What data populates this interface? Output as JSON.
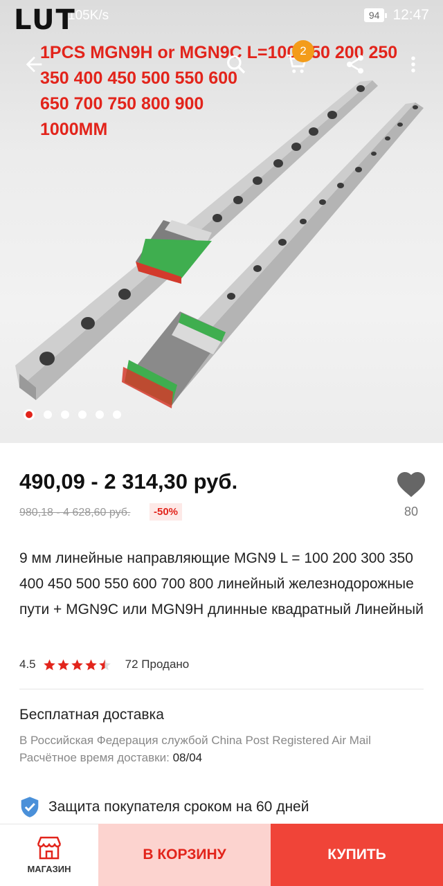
{
  "status_bar": {
    "carrier_logo": "LUT",
    "network_speed": "105K/s",
    "battery": "94",
    "time": "12:47"
  },
  "hero": {
    "promo_lines": [
      "1PCS MGN9H or MGN9C L=100 150 200 250",
      "350 400 450 500 550 600",
      "650 700 750 800 900",
      "1000MM"
    ],
    "cart_count": "2",
    "slides_total": 6,
    "active_slide": 1,
    "icons": [
      "back-arrow-icon",
      "search-icon",
      "cart-icon",
      "share-icon",
      "more-vertical-icon"
    ]
  },
  "product": {
    "price": "490,09 - 2 314,30 руб.",
    "old_price": "980,18 - 4 628,60 руб.",
    "discount": "-50%",
    "favorites_count": "80",
    "title": "9 мм линейные направляющие MGN9 L = 100 200 300 350 400 450 500 550 600 700 800 линейный железнодорожные пути + MGN9C или MGN9H длинные квадратный Линейный",
    "rating": "4.5",
    "rating_value": 4.5,
    "sold": "72 Продано"
  },
  "shipping": {
    "title": "Бесплатная доставка",
    "description": "В Российская Федерация службой China Post Registered Air Mail",
    "time_label": "Расчётное время доставки:",
    "time_value": "08/04"
  },
  "protection": {
    "text": "Защита покупателя сроком на 60 дней"
  },
  "bottom_bar": {
    "store_label": "МАГАЗИН",
    "add_to_cart": "В КОРЗИНУ",
    "buy_now": "КУПИТЬ"
  },
  "colors": {
    "accent": "#e2241b",
    "buy_button": "#f04438",
    "cart_button_bg": "#fcd3cf",
    "badge": "#f39c1a"
  }
}
